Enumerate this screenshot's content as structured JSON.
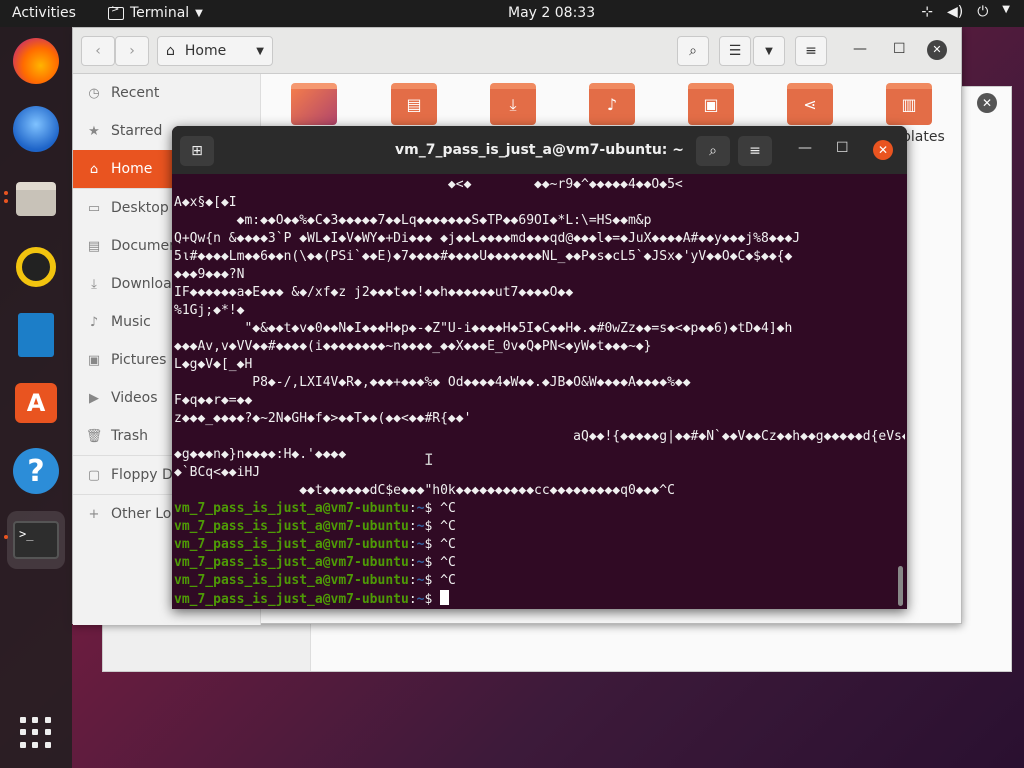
{
  "topbar": {
    "activities": "Activities",
    "app_name": "Terminal",
    "clock": "May 2  08:33"
  },
  "dock": {
    "items": [
      "firefox-icon",
      "thunderbird-icon",
      "files-icon",
      "rhythmbox-icon",
      "writer-icon",
      "software-icon",
      "help-icon",
      "terminal-icon"
    ]
  },
  "files": {
    "path_label": "Home",
    "sidebar": [
      {
        "label": "Recent",
        "icon": "clock-icon"
      },
      {
        "label": "Starred",
        "icon": "star-icon"
      },
      {
        "label": "Home",
        "icon": "home-icon"
      },
      {
        "label": "Desktop",
        "icon": "desktop-icon"
      },
      {
        "label": "Documents",
        "icon": "document-icon"
      },
      {
        "label": "Downloads",
        "icon": "download-icon"
      },
      {
        "label": "Music",
        "icon": "music-icon"
      },
      {
        "label": "Pictures",
        "icon": "pictures-icon"
      },
      {
        "label": "Videos",
        "icon": "videos-icon"
      },
      {
        "label": "Trash",
        "icon": "trash-icon"
      },
      {
        "label": "Floppy Disk",
        "icon": "floppy-icon"
      },
      {
        "label": "Other Locations",
        "icon": "plus-icon"
      }
    ],
    "folders": [
      "desktop-folder",
      "documents-folder",
      "downloads-folder",
      "music-folder",
      "pictures-folder",
      "public-folder",
      "templates-folder"
    ],
    "templates_label": "plates"
  },
  "terminal": {
    "title": "vm_7_pass_is_just_a@vm7-ubuntu: ~",
    "garbage_lines": [
      "                                   ◆<◆        ◆◆~r9◆^◆◆◆◆◆4◆◆O◆5<",
      "A◆x§◆[◆I",
      "        ◆m:◆◆O◆◆%◆C◆3◆◆◆◆◆7◆◆Lq◆◆◆◆◆◆◆S◆TP◆◆69OI◆*L:\\=HS◆◆m&p",
      "Q+Qw{n &◆◆◆◆3`P ◆WL◆I◆V◆WY◆+Di◆◆◆ ◆j◆◆L◆◆◆◆md◆◆◆qd@◆◆◆l◆=◆JuX◆◆◆◆A#◆◆y◆◆◆j%8◆◆◆J",
      "5ι#◆◆◆◆Lm◆◆6◆◆n(\\◆◆(PSi`◆◆E)◆7◆◆◆◆#◆◆◆◆U◆◆◆◆◆◆◆NL_◆◆P◆s◆cL5`◆JSx◆'yV◆◆O◆C◆$◆◆{◆",
      "◆◆◆9◆◆◆?N",
      "IF◆◆◆◆◆◆a◆E◆◆◆ &◆/xf◆z j2◆◆◆t◆◆!◆◆h◆◆◆◆◆◆ut7◆◆◆◆O◆◆",
      "%1Gj;◆*!◆",
      "         \"◆&◆◆t◆v◆0◆◆N◆I◆◆◆H◆p◆-◆Z\"U-i◆◆◆◆H◆5I◆C◆◆H◆.◆#0wZz◆◆=s◆<◆p◆◆6)◆tD◆4]◆h",
      "◆◆◆Av,v◆VV◆◆#◆◆◆◆(i◆◆◆◆◆◆◆◆~n◆◆◆◆_◆◆X◆◆◆E_0v◆Q◆PN<◆yW◆t◆◆◆~◆}",
      "L◆g◆V◆[_◆H",
      "          P8◆-/,LXI4V◆R◆,◆◆◆+◆◆◆%◆ Od◆◆◆◆4◆W◆◆.◆JB◆O&W◆◆◆◆A◆◆◆◆%◆◆",
      "F◆q◆◆r◆=◆◆",
      "z◆◆◆_◆◆◆◆?◆~2N◆GH◆f◆>◆◆T◆◆(◆◆<◆◆#R{◆◆'",
      "                                                   aQ◆◆!{◆◆◆◆◆g|◆◆#◆N`◆◆V◆◆Cz◆◆h◆◆g◆◆◆◆◆d{eVs◆",
      "◆g◆◆◆n◆}n◆◆◆◆:H◆.'◆◆◆◆",
      "◆`BCq<◆◆iHJ",
      "                ◆◆t◆◆◆◆◆◆dC$e◆◆◆\"h0k◆◆◆◆◆◆◆◆◆◆cc◆◆◆◆◆◆◆◆◆q0◆◆◆^C"
    ],
    "prompt_user": "vm_7_pass_is_just_a@vm7-ubuntu",
    "prompt_sep": ":",
    "prompt_path": "~",
    "prompt_dollar": "$ ",
    "prompt_commands": [
      "^C",
      "^C",
      "^C",
      "^C",
      "^C",
      ""
    ]
  }
}
